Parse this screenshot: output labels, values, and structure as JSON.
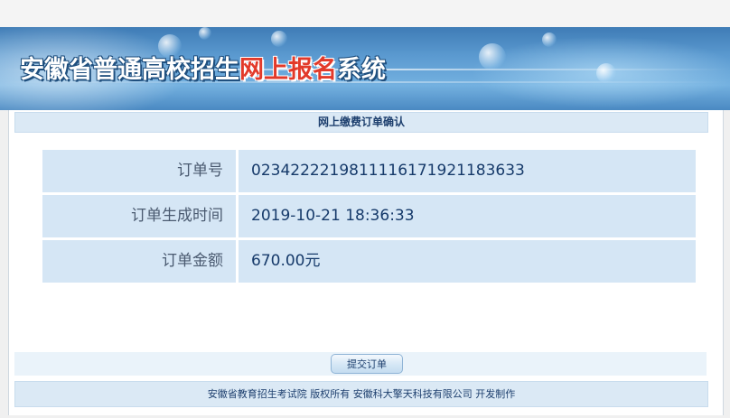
{
  "header": {
    "title_part1": "安徽省普通高校招生",
    "title_part2": "网上报名",
    "title_part3": "系统"
  },
  "section": {
    "title": "网上缴费订单确认"
  },
  "order": {
    "rows": [
      {
        "label": "订单号",
        "value": "02342222198111161719211836 33"
      },
      {
        "label": "订单生成时间",
        "value": "2019-10-21 18:36:33"
      },
      {
        "label": "订单金额",
        "value": "670.00",
        "unit": "元"
      }
    ]
  },
  "actions": {
    "submit_label": "提交订单"
  },
  "footer": {
    "text": "安徽省教育招生考试院  版权所有  安徽科大擎天科技有限公司  开发制作"
  }
}
